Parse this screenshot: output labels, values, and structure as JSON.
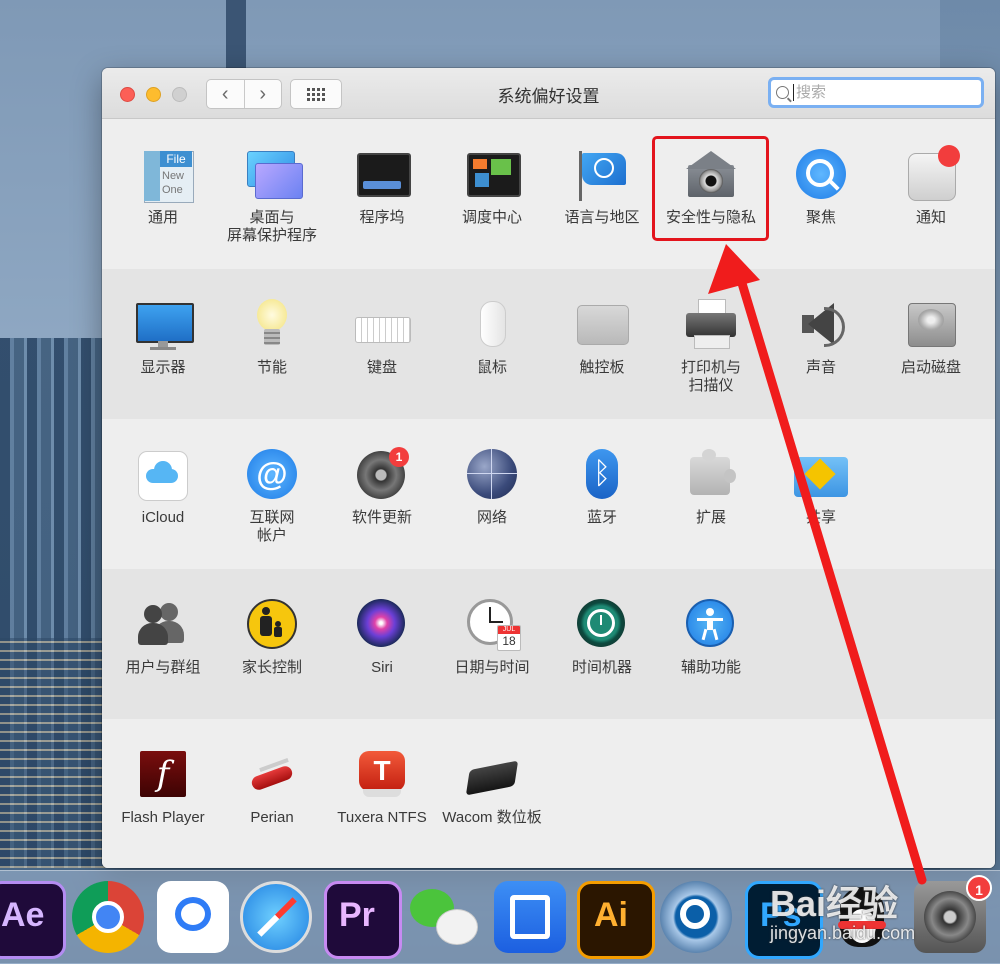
{
  "window": {
    "title": "系统偏好设置",
    "search_placeholder": "搜索"
  },
  "sections": [
    [
      {
        "label": "通用",
        "icon": "general-icon"
      },
      {
        "label": "桌面与",
        "label2": "屏幕保护程序",
        "icon": "desktop-screensaver-icon"
      },
      {
        "label": "程序坞",
        "icon": "dock-icon"
      },
      {
        "label": "调度中心",
        "icon": "mission-control-icon"
      },
      {
        "label": "语言与地区",
        "icon": "flag-icon"
      },
      {
        "label": "安全性与隐私",
        "icon": "security-house-icon"
      },
      {
        "label": "聚焦",
        "icon": "spotlight-icon"
      },
      {
        "label": "通知",
        "icon": "notifications-icon"
      }
    ],
    [
      {
        "label": "显示器",
        "icon": "display-icon"
      },
      {
        "label": "节能",
        "icon": "lightbulb-icon"
      },
      {
        "label": "键盘",
        "icon": "keyboard-icon"
      },
      {
        "label": "鼠标",
        "icon": "mouse-icon"
      },
      {
        "label": "触控板",
        "icon": "trackpad-icon"
      },
      {
        "label": "打印机与",
        "label2": "扫描仪",
        "icon": "printer-icon"
      },
      {
        "label": "声音",
        "icon": "speaker-icon"
      },
      {
        "label": "启动磁盘",
        "icon": "hard-disk-icon"
      }
    ],
    [
      {
        "label": "iCloud",
        "icon": "icloud-icon"
      },
      {
        "label": "互联网",
        "label2": "帐户",
        "icon": "at-icon"
      },
      {
        "label": "软件更新",
        "icon": "software-update-gear-icon",
        "badge": "1"
      },
      {
        "label": "网络",
        "icon": "network-globe-icon"
      },
      {
        "label": "蓝牙",
        "icon": "bluetooth-icon"
      },
      {
        "label": "扩展",
        "icon": "puzzle-icon"
      },
      {
        "label": "共享",
        "icon": "sharing-folder-icon"
      }
    ],
    [
      {
        "label": "用户与群组",
        "icon": "users-icon"
      },
      {
        "label": "家长控制",
        "icon": "parental-controls-icon"
      },
      {
        "label": "Siri",
        "icon": "siri-icon"
      },
      {
        "label": "日期与时间",
        "icon": "clock-calendar-icon",
        "cal_month": "JUL",
        "cal_day": "18"
      },
      {
        "label": "时间机器",
        "icon": "time-machine-icon"
      },
      {
        "label": "辅助功能",
        "icon": "accessibility-icon"
      }
    ],
    [
      {
        "label": "Flash Player",
        "icon": "flash-player-icon"
      },
      {
        "label": "Perian",
        "icon": "perian-knife-icon"
      },
      {
        "label": "Tuxera NTFS",
        "icon": "tuxera-icon"
      },
      {
        "label": "Wacom 数位板",
        "icon": "wacom-tablet-icon"
      }
    ]
  ],
  "icon_text": {
    "general_file": "File",
    "general_new": "New",
    "general_one": "One"
  },
  "dock": {
    "ae": "Ae",
    "pr": "Pr",
    "ai": "Ai",
    "ps": "Ps",
    "sysprefs_badge": "1",
    "watermark": "Bai经验",
    "watermark_url": "jingyan.baidu.com"
  },
  "colors": {
    "highlight": "#e3141c",
    "arrow": "#f01c1c",
    "search_focus": "#7ab0f2"
  }
}
